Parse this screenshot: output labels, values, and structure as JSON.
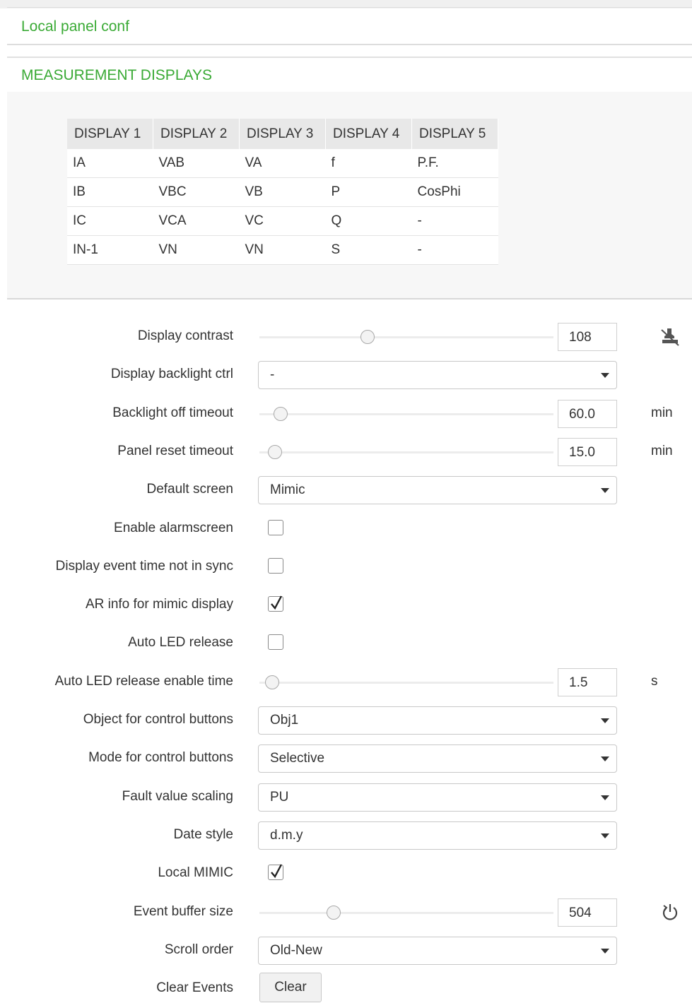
{
  "header": {
    "title": "Local panel conf"
  },
  "section": {
    "title": "MEASUREMENT DISPLAYS"
  },
  "measurement_table": {
    "columns": [
      "DISPLAY 1",
      "DISPLAY 2",
      "DISPLAY 3",
      "DISPLAY 4",
      "DISPLAY 5"
    ],
    "rows": [
      [
        "IA",
        "VAB",
        "VA",
        "f",
        "P.F."
      ],
      [
        "IB",
        "VBC",
        "VB",
        "P",
        "CosPhi"
      ],
      [
        "IC",
        "VCA",
        "VC",
        "Q",
        "-"
      ],
      [
        "IN-1",
        "VN",
        "VN",
        "S",
        "-"
      ]
    ]
  },
  "settings": {
    "display_contrast": {
      "label": "Display contrast",
      "value": "108",
      "slider_fraction": 0.36
    },
    "display_backlight_ctrl": {
      "label": "Display backlight ctrl",
      "value": "-"
    },
    "backlight_off_timeout": {
      "label": "Backlight off timeout",
      "value": "60.0",
      "unit": "min",
      "slider_fraction": 0.05
    },
    "panel_reset_timeout": {
      "label": "Panel reset timeout",
      "value": "15.0",
      "unit": "min",
      "slider_fraction": 0.03
    },
    "default_screen": {
      "label": "Default screen",
      "value": "Mimic"
    },
    "enable_alarmscreen": {
      "label": "Enable alarmscreen",
      "checked": false
    },
    "display_event_time": {
      "label": "Display event time not in sync",
      "checked": false
    },
    "ar_info_mimic": {
      "label": "AR info for mimic display",
      "checked": true
    },
    "auto_led_release": {
      "label": "Auto LED release",
      "checked": false
    },
    "auto_led_release_time": {
      "label": "Auto LED release enable time",
      "value": "1.5",
      "unit": "s",
      "slider_fraction": 0.02
    },
    "object_control_buttons": {
      "label": "Object for control buttons",
      "value": "Obj1"
    },
    "mode_control_buttons": {
      "label": "Mode for control buttons",
      "value": "Selective"
    },
    "fault_value_scaling": {
      "label": "Fault value scaling",
      "value": "PU"
    },
    "date_style": {
      "label": "Date style",
      "value": "d.m.y"
    },
    "local_mimic": {
      "label": "Local MIMIC",
      "checked": true
    },
    "event_buffer_size": {
      "label": "Event buffer size",
      "value": "504",
      "slider_fraction": 0.24
    },
    "scroll_order": {
      "label": "Scroll order",
      "value": "Old-New"
    },
    "clear_events": {
      "label": "Clear Events",
      "button": "Clear"
    }
  },
  "icons": {
    "contrast_action": "stamp-icon",
    "event_buffer_action": "power-restart-icon"
  }
}
